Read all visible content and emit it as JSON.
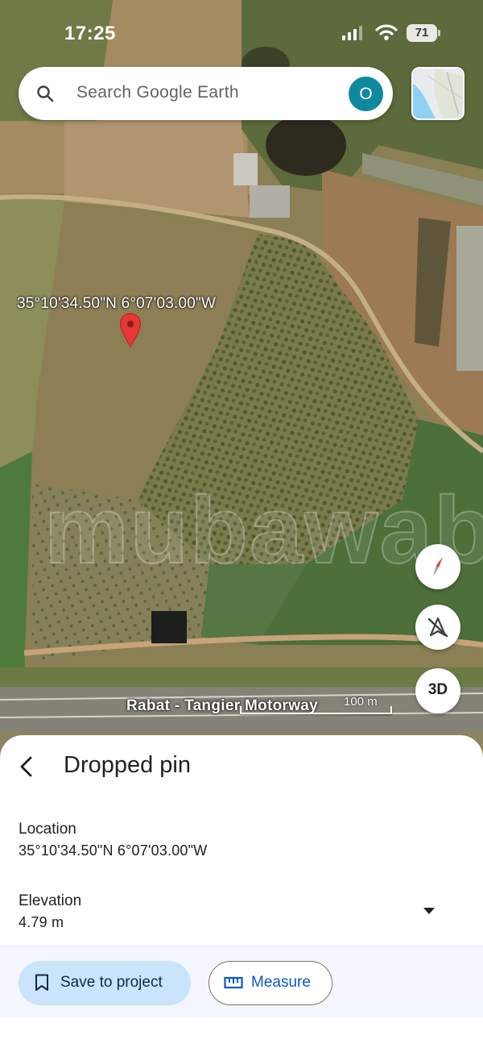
{
  "status_bar": {
    "time": "17:25",
    "battery": "71"
  },
  "search": {
    "placeholder": "Search Google Earth",
    "avatar_initial": "O"
  },
  "map": {
    "pin_coordinates": "35°10'34.50\"N 6°07'03.00\"W",
    "watermark": "mubawab",
    "road_name": "Rabat - Tangier Motorway",
    "scale": "100 m",
    "buttons": {
      "three_d": "3D"
    }
  },
  "sheet": {
    "title": "Dropped pin",
    "location": {
      "label": "Location",
      "value": "35°10'34.50\"N 6°07'03.00\"W"
    },
    "elevation": {
      "label": "Elevation",
      "value": "4.79 m"
    },
    "actions": {
      "save": "Save to project",
      "measure": "Measure"
    }
  },
  "colors": {
    "avatar": "#0e8a9f",
    "pin": "#e53935",
    "save_button_bg": "#c9e4fb",
    "measure_text": "#0b57d0"
  },
  "icons": [
    "search-icon",
    "signal-icon",
    "wifi-icon",
    "battery-icon",
    "layers-icon",
    "map-pin-icon",
    "compass-icon",
    "tilt-icon",
    "back-arrow-icon",
    "chevron-down-icon",
    "bookmark-icon",
    "ruler-icon"
  ]
}
